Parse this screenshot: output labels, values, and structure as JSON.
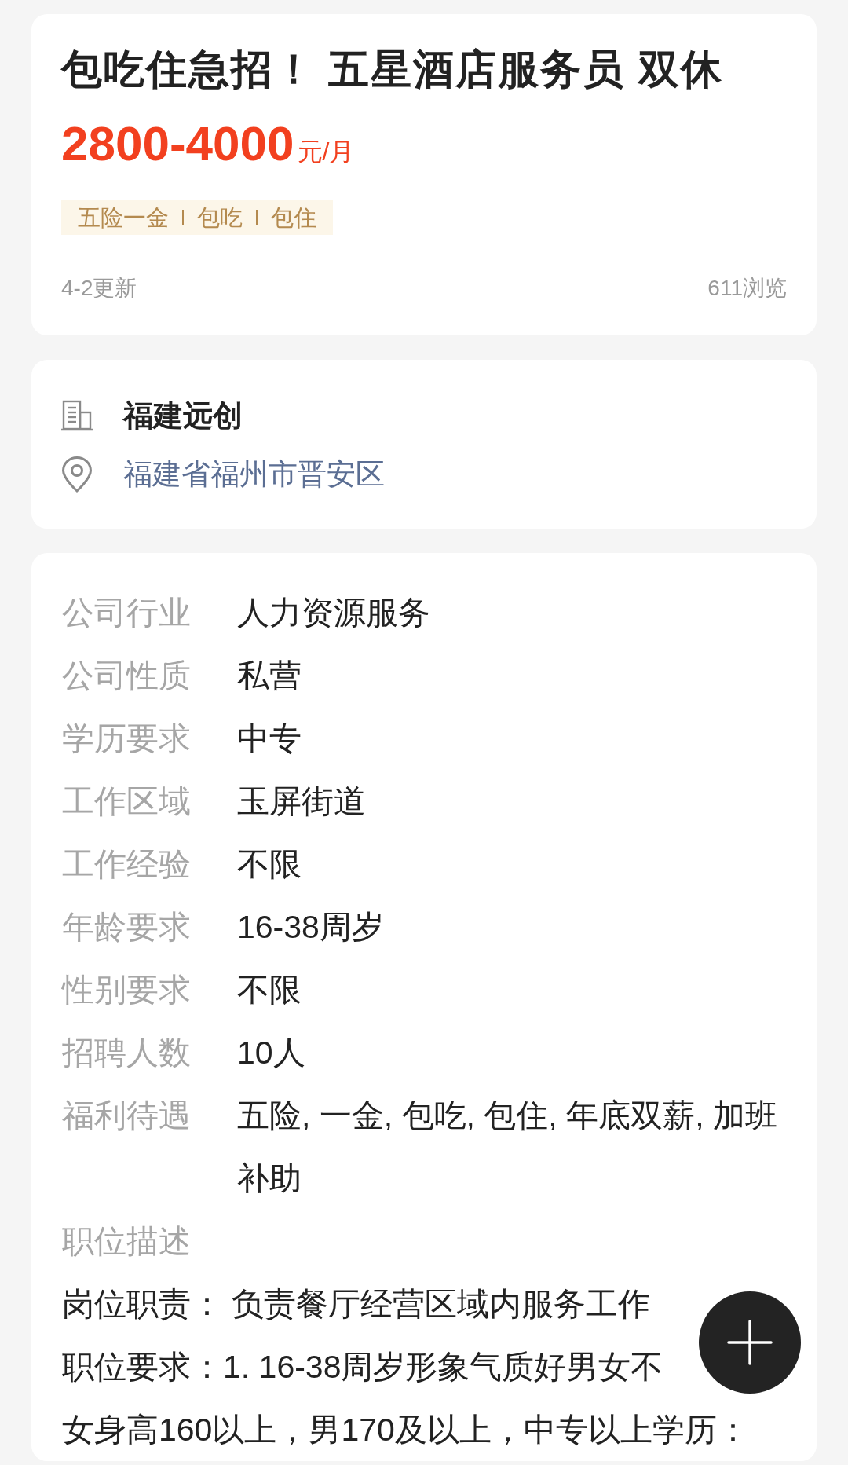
{
  "job": {
    "title": "包吃住急招！ 五星酒店服务员 双休",
    "salary": {
      "amount": "2800-4000",
      "unit": "元/月"
    },
    "tags": [
      "五险一金",
      "包吃",
      "包住"
    ],
    "updated": "4-2更新",
    "views": "611浏览"
  },
  "company": {
    "name": "福建远创",
    "address": "福建省福州市晋安区"
  },
  "details": [
    {
      "label": "公司行业",
      "value": "人力资源服务"
    },
    {
      "label": "公司性质",
      "value": "私营"
    },
    {
      "label": "学历要求",
      "value": "中专"
    },
    {
      "label": "工作区域",
      "value": "玉屏街道"
    },
    {
      "label": "工作经验",
      "value": "不限"
    },
    {
      "label": "年龄要求",
      "value": "16-38周岁"
    },
    {
      "label": "性别要求",
      "value": "不限"
    },
    {
      "label": "招聘人数",
      "value": "10人"
    },
    {
      "label": "福利待遇",
      "value": "五险, 一金, 包吃, 包住, 年底双薪, 加班补助"
    }
  ],
  "description": {
    "label": "职位描述",
    "lines": [
      "岗位职责： 负责餐厅经营区域内服务工作",
      "职位要求：1. 16-38周岁形象气质好男女不",
      "女身高160以上，男170及以上，中专以上学历："
    ]
  }
}
